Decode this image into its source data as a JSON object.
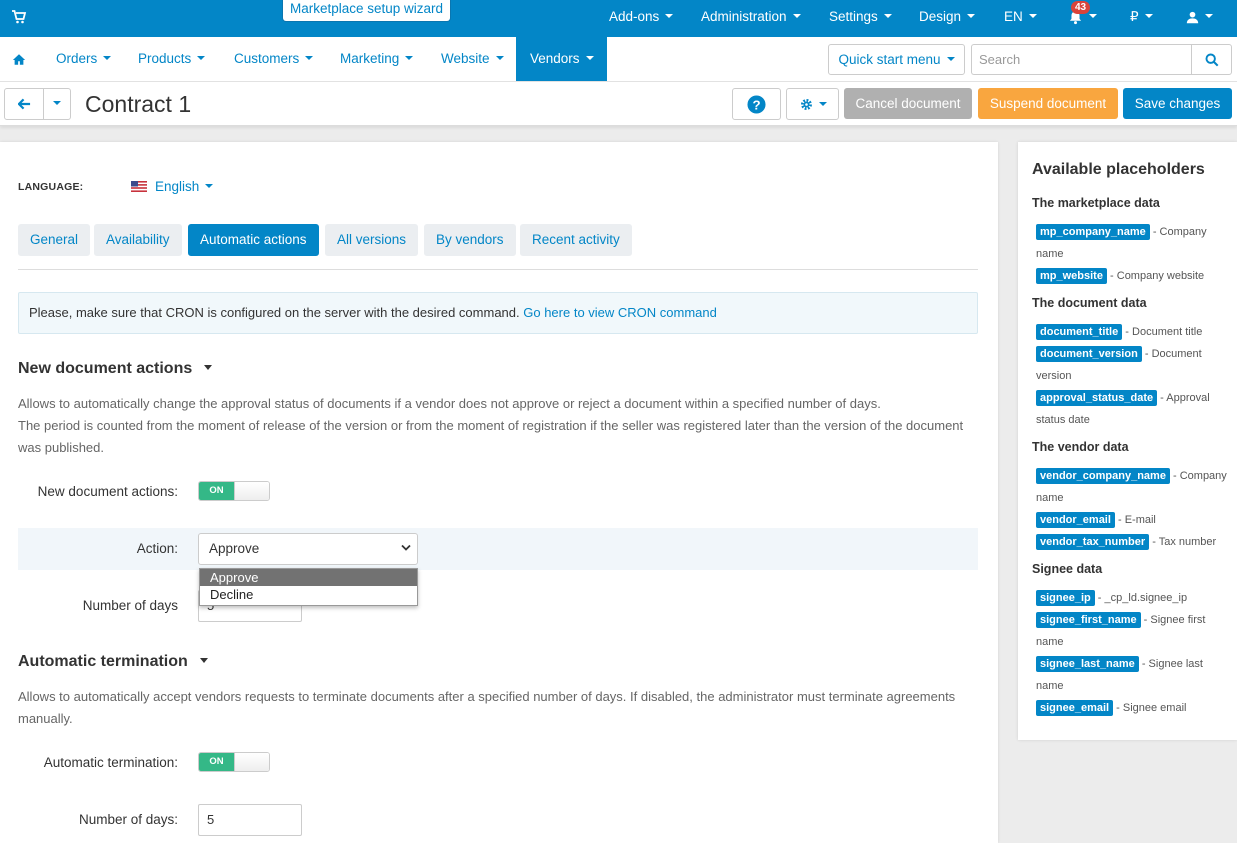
{
  "topbar": {
    "wizard_label": "Marketplace setup wizard",
    "menu": [
      "Add-ons",
      "Administration",
      "Settings",
      "Design",
      "EN"
    ],
    "notifications_count": "43",
    "currency": "₽",
    "icons": [
      "cart-icon",
      "bell-icon",
      "user-icon"
    ]
  },
  "nav": {
    "items": [
      "Orders",
      "Products",
      "Customers",
      "Marketing",
      "Website",
      "Vendors"
    ],
    "active": "Vendors",
    "quick_start": "Quick start menu",
    "search_placeholder": "Search"
  },
  "titlebar": {
    "title": "Contract 1",
    "cancel_label": "Cancel document",
    "suspend_label": "Suspend document",
    "save_label": "Save changes"
  },
  "main": {
    "language_label": "LANGUAGE:",
    "language_value": "English",
    "tabs": [
      "General",
      "Availability",
      "Automatic actions",
      "All versions",
      "By vendors",
      "Recent activity"
    ],
    "active_tab": "Automatic actions",
    "cron_notice": "Please, make sure that CRON is configured on the server with the desired command.",
    "cron_link": "Go here to view CRON command",
    "new_doc": {
      "heading": "New document actions",
      "desc_1": "Allows to automatically change the approval status of documents if a vendor does not approve or reject a document within a specified number of days.",
      "desc_2": "The period is counted from the moment of release of the version or from the moment of registration if the seller was registered later than the version of the document was published.",
      "toggle_label": "New document actions:",
      "toggle_state": "ON",
      "action_label": "Action:",
      "action_value": "Approve",
      "action_options": [
        "Approve",
        "Decline"
      ],
      "days_label": "Number of days",
      "days_value": "5"
    },
    "termination": {
      "heading": "Automatic termination",
      "desc": "Allows to automatically accept vendors requests to terminate documents after a specified number of days. If disabled, the administrator must terminate agreements manually.",
      "toggle_label": "Automatic termination:",
      "toggle_state": "ON",
      "days_label": "Number of days:",
      "days_value": "5"
    }
  },
  "sidebar": {
    "title": "Available placeholders",
    "groups": [
      {
        "heading": "The marketplace data",
        "items": [
          {
            "tag": "mp_company_name",
            "text": " - Company name"
          },
          {
            "tag": "mp_website",
            "text": " - Company website"
          }
        ]
      },
      {
        "heading": "The document data",
        "items": [
          {
            "tag": "document_title",
            "text": " - Document title"
          },
          {
            "tag": "document_version",
            "text": " - Document version"
          },
          {
            "tag": "approval_status_date",
            "text": " - Approval status date"
          }
        ]
      },
      {
        "heading": "The vendor data",
        "items": [
          {
            "tag": "vendor_company_name",
            "text": " - Company name"
          },
          {
            "tag": "vendor_email",
            "text": " - E-mail"
          },
          {
            "tag": "vendor_tax_number",
            "text": " - Tax number"
          }
        ]
      },
      {
        "heading": "Signee data",
        "items": [
          {
            "tag": "signee_ip",
            "text": " - _cp_ld.signee_ip"
          },
          {
            "tag": "signee_first_name",
            "text": " - Signee first name"
          },
          {
            "tag": "signee_last_name",
            "text": " - Signee last name"
          },
          {
            "tag": "signee_email",
            "text": " - Signee email"
          }
        ]
      }
    ]
  },
  "colors": {
    "brand": "#0386c7",
    "suspend": "#f9a63f",
    "cancel": "#b0b0b0",
    "toggle_on": "#34b887"
  }
}
